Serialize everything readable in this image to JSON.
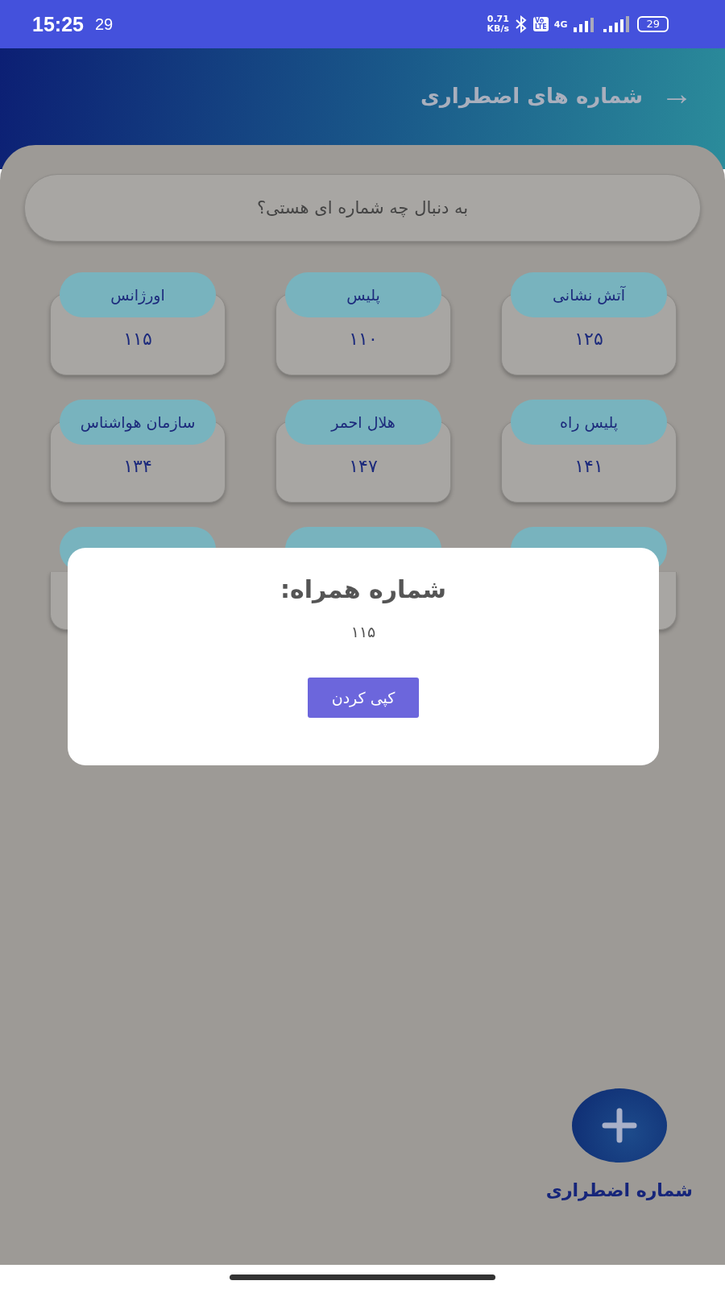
{
  "status_bar": {
    "time": "15:25",
    "notification": "29",
    "speed_value": "0.71",
    "speed_unit": "KB/s",
    "volte_top": "Vo",
    "volte_bottom": "LTE",
    "network": "4G",
    "battery": "29"
  },
  "header": {
    "back_icon": "→",
    "title": "شماره های اضطراری"
  },
  "search": {
    "placeholder": "به دنبال چه شماره ای هستی؟"
  },
  "cards": [
    {
      "kind": "contact",
      "label": "آتش نشانی",
      "number": "۱۲۵"
    },
    {
      "kind": "contact",
      "label": "پلیس",
      "number": "۱۱۰"
    },
    {
      "kind": "contact",
      "label": "اورژانس",
      "number": "۱۱۵"
    },
    {
      "kind": "contact",
      "label": "پلیس راه",
      "number": "۱۴۱"
    },
    {
      "kind": "contact",
      "label": "هلال احمر",
      "number": "۱۴۷"
    },
    {
      "kind": "contact",
      "label": "سازمان هواشناس",
      "number": "۱۳۴"
    },
    {
      "kind": "covered"
    },
    {
      "kind": "covered_label"
    },
    {
      "kind": "covered"
    }
  ],
  "dialog": {
    "title": "شماره همراه:",
    "number": "۱۱۵",
    "button": "کپی کردن"
  },
  "fab": {
    "label": "شماره اضطراری"
  }
}
